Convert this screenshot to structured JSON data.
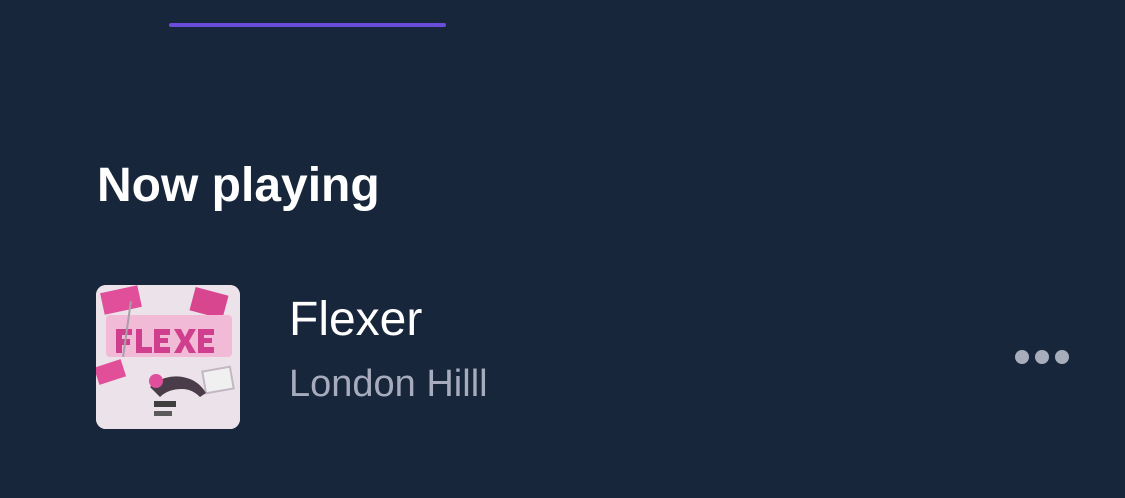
{
  "header": {
    "active_tab_indicator_color": "#6a4ddb"
  },
  "section": {
    "title": "Now playing"
  },
  "now_playing": {
    "track_title": "Flexer",
    "artist": "London Hilll",
    "artwork_icon": "album-artwork",
    "more_icon": "more-horizontal-icon"
  },
  "colors": {
    "background": "#17263a",
    "text_primary": "#ffffff",
    "text_secondary": "#a6acbd",
    "accent": "#6a4ddb"
  }
}
